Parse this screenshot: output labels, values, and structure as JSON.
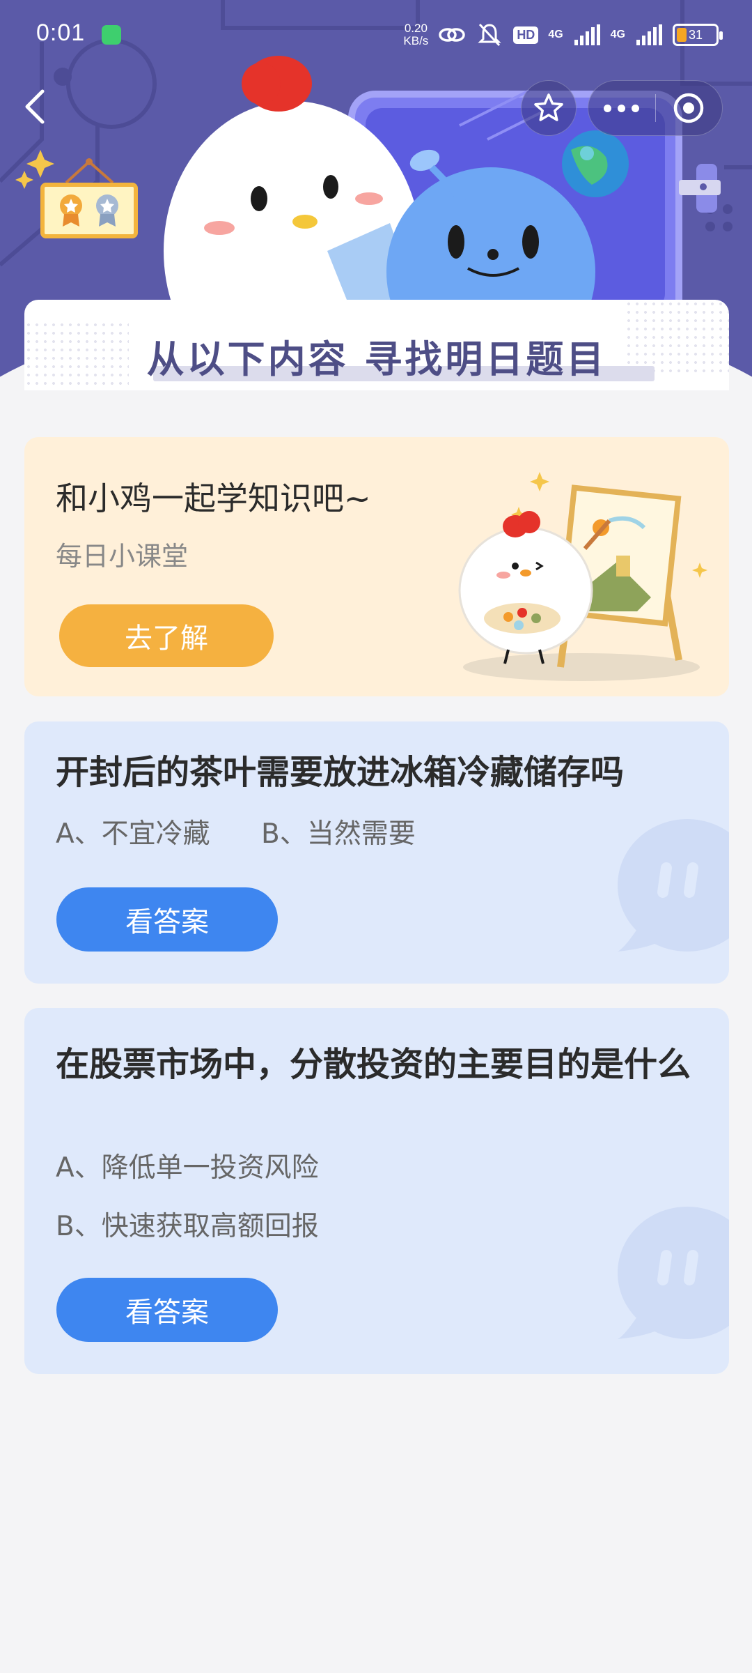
{
  "status_bar": {
    "time": "0:01",
    "network_speed_value": "0.20",
    "network_speed_unit": "KB/s",
    "hd_label": "HD",
    "signal1_label": "4G",
    "signal2_label": "4G",
    "battery_level": "31"
  },
  "banner": {
    "text": "从以下内容  寻找明日题目"
  },
  "lesson_card": {
    "title": "和小鸡一起学知识吧~",
    "subtitle": "每日小课堂",
    "button_label": "去了解"
  },
  "questions": [
    {
      "title": "开封后的茶叶需要放进冰箱冷藏储存吗",
      "option_a": "A、不宜冷藏",
      "option_b": "B、当然需要",
      "button_label": "看答案"
    },
    {
      "title": "在股票市场中，分散投资的主要目的是什么",
      "option_a": "A、降低单一投资风险",
      "option_b": "B、快速获取高额回报",
      "button_label": "看答案"
    }
  ],
  "colors": {
    "header_bg": "#5b5aa8",
    "lesson_card_bg": "#fff0d9",
    "question_card_bg": "#dfe9fb",
    "primary_button": "#3e86f0",
    "orange_button": "#f5b140"
  },
  "icons": {
    "back": "back-chevron-icon",
    "star": "star-outline-icon",
    "more": "more-dots-icon",
    "close": "target-close-icon"
  }
}
